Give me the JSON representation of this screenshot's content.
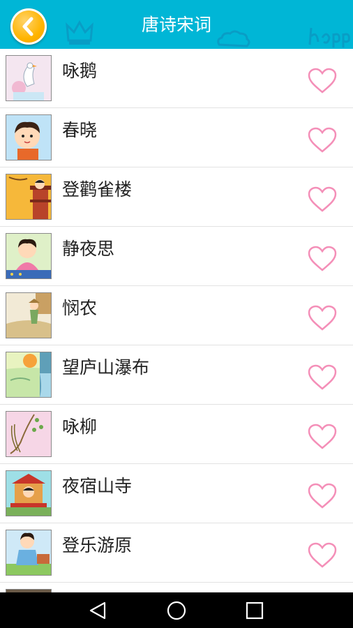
{
  "header": {
    "title": "唐诗宋词",
    "background_color": "#00b6d6",
    "back_icon": "chevron-left-icon",
    "back_button_color": "#ffb400",
    "decorations": [
      "crown-icon",
      "cloud-icon",
      "happy-text-decoration"
    ]
  },
  "list": {
    "items": [
      {
        "title": "咏鹅",
        "thumbnail": "goose-illustration",
        "favorite_icon": "heart-outline-icon"
      },
      {
        "title": "春晓",
        "thumbnail": "child-thinking-illustration",
        "favorite_icon": "heart-outline-icon"
      },
      {
        "title": "登鹳雀楼",
        "thumbnail": "tower-climbing-illustration",
        "favorite_icon": "heart-outline-icon"
      },
      {
        "title": "静夜思",
        "thumbnail": "child-sitting-illustration",
        "favorite_icon": "heart-outline-icon"
      },
      {
        "title": "悯农",
        "thumbnail": "farmer-field-illustration",
        "favorite_icon": "heart-outline-icon"
      },
      {
        "title": "望庐山瀑布",
        "thumbnail": "waterfall-sunset-illustration",
        "favorite_icon": "heart-outline-icon"
      },
      {
        "title": "咏柳",
        "thumbnail": "willow-branch-illustration",
        "favorite_icon": "heart-outline-icon"
      },
      {
        "title": "夜宿山寺",
        "thumbnail": "temple-illustration",
        "favorite_icon": "heart-outline-icon"
      },
      {
        "title": "登乐游原",
        "thumbnail": "child-walking-illustration",
        "favorite_icon": "heart-outline-icon"
      }
    ],
    "heart_color": "#f48fb8",
    "divider_color": "#e2e2e2"
  },
  "navbar": {
    "buttons": [
      "back-triangle-icon",
      "home-circle-icon",
      "recents-square-icon"
    ],
    "background_color": "#000000"
  }
}
